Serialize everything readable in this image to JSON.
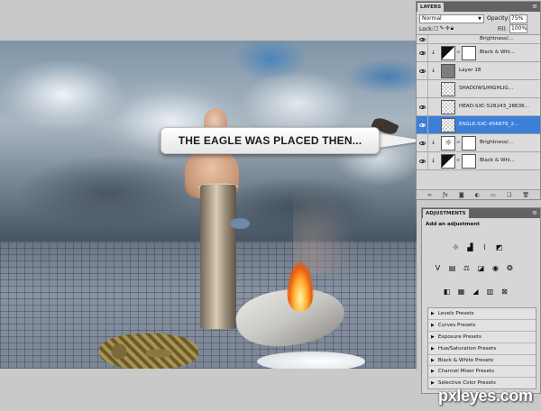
{
  "callout": {
    "text": "THE EAGLE WAS PLACED THEN..."
  },
  "layers_panel": {
    "tab": "LAYERS",
    "blend_mode": "Normal",
    "opacity_label": "Opacity:",
    "opacity_value": "75%",
    "lock_label": "Lock:",
    "fill_label": "Fill:",
    "fill_value": "100%",
    "layers": [
      {
        "name": "Brightness/...",
        "kind": "adjustment",
        "icon": "brightness-icon",
        "visible": true
      },
      {
        "name": "Black & Whi...",
        "kind": "adjustment",
        "icon": "black-white-icon",
        "visible": true
      },
      {
        "name": "Layer 18",
        "kind": "pixel",
        "visible": true
      },
      {
        "name": "SHADOWS/HIGHLIG...",
        "kind": "smart",
        "visible": false
      },
      {
        "name": "HEAD-SXC-528243_28636...",
        "kind": "smart",
        "visible": true
      },
      {
        "name": "EAGLE-SXC-456876_2...",
        "kind": "smart",
        "visible": true,
        "selected": true
      },
      {
        "name": "Brightness/...",
        "kind": "adjustment",
        "icon": "brightness-icon",
        "visible": true
      },
      {
        "name": "Black & Whi...",
        "kind": "adjustment",
        "icon": "black-white-icon",
        "visible": true
      }
    ]
  },
  "adjustments_panel": {
    "tab": "ADJUSTMENTS",
    "subtitle": "Add an adjustment",
    "presets": [
      "Levels Presets",
      "Curves Presets",
      "Exposure Presets",
      "Hue/Saturation Presets",
      "Black & White Presets",
      "Channel Mixer Presets",
      "Selective Color Presets"
    ]
  },
  "watermark": {
    "text": "pxleyes.com"
  },
  "colors": {
    "selection": "#3b7fd9",
    "panel_bg": "#d6d6d6",
    "workspace_bg": "#c9c9c9"
  }
}
